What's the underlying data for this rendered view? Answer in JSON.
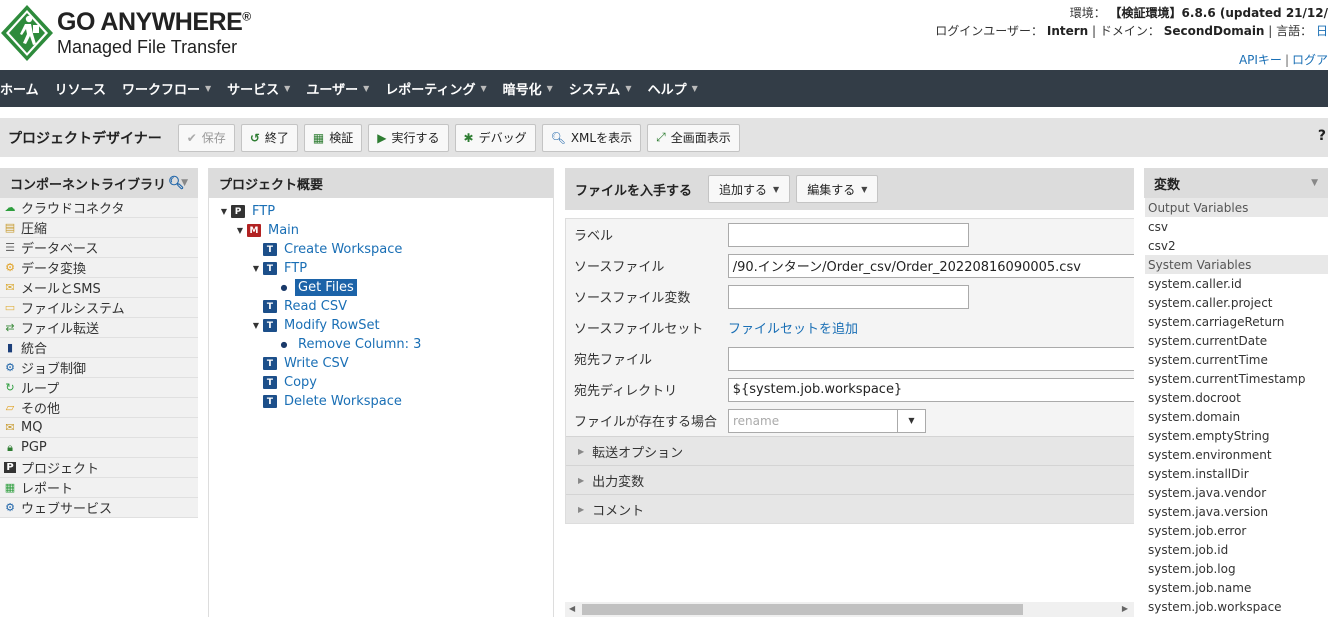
{
  "header": {
    "brand_line1": "GO ANYWHERE",
    "brand_reg": "®",
    "brand_line2": "Managed File Transfer",
    "env_label": "環境：",
    "env_value": "【検証環境】6.8.6 (updated 21/12/",
    "login_label": "ログインユーザー：",
    "login_user": "Intern",
    "domain_label": "| ドメイン：",
    "domain_value": "SecondDomain",
    "lang_label": "| 言語：",
    "lang_value": "日",
    "api_key": "APIキー",
    "logout": "ログア"
  },
  "nav": {
    "items": [
      {
        "label": "ホーム",
        "caret": false
      },
      {
        "label": "リソース",
        "caret": false
      },
      {
        "label": "ワークフロー",
        "caret": true
      },
      {
        "label": "サービス",
        "caret": true
      },
      {
        "label": "ユーザー",
        "caret": true
      },
      {
        "label": "レポーティング",
        "caret": true
      },
      {
        "label": "暗号化",
        "caret": true
      },
      {
        "label": "システム",
        "caret": true
      },
      {
        "label": "ヘルプ",
        "caret": true
      }
    ]
  },
  "toolbar": {
    "title": "プロジェクトデザイナー",
    "save": "保存",
    "exit": "終了",
    "validate": "検証",
    "run": "実行する",
    "debug": "デバッグ",
    "view_xml": "XMLを表示",
    "fullscreen": "全画面表示",
    "help": "?"
  },
  "library": {
    "title": "コンポーネントライブラリ",
    "items": [
      {
        "label": "クラウドコネクタ",
        "icon": "cloud-icon",
        "color": "#2e9e3e"
      },
      {
        "label": "圧縮",
        "icon": "archive-icon",
        "color": "#c79a2e"
      },
      {
        "label": "データベース",
        "icon": "database-icon",
        "color": "#666666"
      },
      {
        "label": "データ変換",
        "icon": "transform-icon",
        "color": "#e0a020"
      },
      {
        "label": "メールとSMS",
        "icon": "mail-icon",
        "color": "#d9a830"
      },
      {
        "label": "ファイルシステム",
        "icon": "folder-icon",
        "color": "#e0b040"
      },
      {
        "label": "ファイル転送",
        "icon": "transfer-icon",
        "color": "#3a8a3a"
      },
      {
        "label": "統合",
        "icon": "integration-icon",
        "color": "#1c3f7a"
      },
      {
        "label": "ジョブ制御",
        "icon": "gear-icon",
        "color": "#1c63a8"
      },
      {
        "label": "ループ",
        "icon": "loop-icon",
        "color": "#2e9e3e"
      },
      {
        "label": "その他",
        "icon": "folder-open-icon",
        "color": "#e0a020"
      },
      {
        "label": "MQ",
        "icon": "mq-icon",
        "color": "#c79a2e"
      },
      {
        "label": "PGP",
        "icon": "lock-icon",
        "color": "#2e7d32"
      },
      {
        "label": "プロジェクト",
        "icon": "project-icon",
        "color": "#333333"
      },
      {
        "label": "レポート",
        "icon": "report-icon",
        "color": "#2e9e3e"
      },
      {
        "label": "ウェブサービス",
        "icon": "webservice-icon",
        "color": "#1c63a8"
      }
    ]
  },
  "overview": {
    "title": "プロジェクト概要",
    "tree": [
      {
        "label": "FTP",
        "depth": 0,
        "toggle": "open",
        "badge": "P",
        "badge_color": "#333333",
        "selected": false
      },
      {
        "label": "Main",
        "depth": 1,
        "toggle": "open",
        "badge": "M",
        "badge_color": "#b22222",
        "selected": false
      },
      {
        "label": "Create Workspace",
        "depth": 2,
        "toggle": "none",
        "badge": "T",
        "badge_color": "#1c4f8a",
        "selected": false
      },
      {
        "label": "FTP",
        "depth": 2,
        "toggle": "open",
        "badge": "T",
        "badge_color": "#1c4f8a",
        "selected": false
      },
      {
        "label": "Get Files",
        "depth": 3,
        "toggle": "none",
        "badge": "dot",
        "badge_color": "#1a3a6a",
        "selected": true
      },
      {
        "label": "Read CSV",
        "depth": 2,
        "toggle": "none",
        "badge": "T",
        "badge_color": "#1c4f8a",
        "selected": false
      },
      {
        "label": "Modify RowSet",
        "depth": 2,
        "toggle": "open",
        "badge": "T",
        "badge_color": "#1c4f8a",
        "selected": false
      },
      {
        "label": "Remove Column: 3",
        "depth": 3,
        "toggle": "none",
        "badge": "dot",
        "badge_color": "#1a3a6a",
        "selected": false
      },
      {
        "label": "Write CSV",
        "depth": 2,
        "toggle": "none",
        "badge": "T",
        "badge_color": "#1c4f8a",
        "selected": false
      },
      {
        "label": "Copy",
        "depth": 2,
        "toggle": "none",
        "badge": "T",
        "badge_color": "#1c4f8a",
        "selected": false
      },
      {
        "label": "Delete Workspace",
        "depth": 2,
        "toggle": "none",
        "badge": "T",
        "badge_color": "#1c4f8a",
        "selected": false
      }
    ]
  },
  "editor": {
    "title": "ファイルを入手する",
    "add_btn": "追加する",
    "edit_btn": "編集する",
    "fields": {
      "label_label": "ラベル",
      "label_value": "",
      "source_file_label": "ソースファイル",
      "source_file_value": "/90.インターン/Order_csv/Order_20220816090005.csv",
      "source_file_var_label": "ソースファイル変数",
      "source_file_var_value": "",
      "source_fileset_label": "ソースファイルセット",
      "source_fileset_link": "ファイルセットを追加",
      "dest_file_label": "宛先ファイル",
      "dest_file_value": "",
      "dest_dir_label": "宛先ディレクトリ",
      "dest_dir_value": "${system.job.workspace}",
      "if_exists_label": "ファイルが存在する場合",
      "if_exists_placeholder": "rename"
    },
    "sections": {
      "transfer": "転送オプション",
      "output": "出力変数",
      "comment": "コメント"
    }
  },
  "variables": {
    "title": "変数",
    "output_header": "Output Variables",
    "output": [
      "csv",
      "csv2"
    ],
    "system_header": "System Variables",
    "system": [
      "system.caller.id",
      "system.caller.project",
      "system.carriageReturn",
      "system.currentDate",
      "system.currentTime",
      "system.currentTimestamp",
      "system.docroot",
      "system.domain",
      "system.emptyString",
      "system.environment",
      "system.installDir",
      "system.java.vendor",
      "system.java.version",
      "system.job.error",
      "system.job.id",
      "system.job.log",
      "system.job.name",
      "system.job.workspace"
    ]
  }
}
